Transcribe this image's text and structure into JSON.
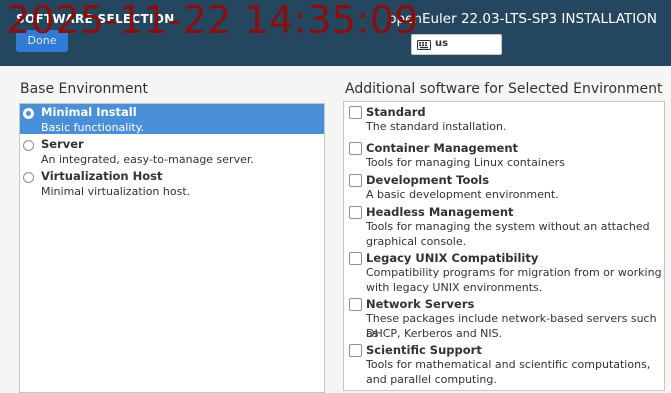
{
  "header": {
    "title": "SOFTWARE SELECTION",
    "done_label": "Done",
    "product": "openEuler 22.03-LTS-SP3 INSTALLATION",
    "keyboard_layout": "us",
    "overlay_timestamp": "2025-11-22 14:35:09"
  },
  "base_environment": {
    "heading": "Base Environment",
    "items": [
      {
        "name": "Minimal Install",
        "description": "Basic functionality.",
        "selected": true
      },
      {
        "name": "Server",
        "description": "An integrated, easy-to-manage server.",
        "selected": false
      },
      {
        "name": "Virtualization Host",
        "description": "Minimal virtualization host.",
        "selected": false
      }
    ]
  },
  "additional_software": {
    "heading": "Additional software for Selected Environment",
    "items": [
      {
        "name": "Standard",
        "description_lines": [
          "The standard installation."
        ],
        "checked": false
      },
      {
        "name": "Container Management",
        "description_lines": [
          "Tools for managing Linux containers"
        ],
        "checked": false
      },
      {
        "name": "Development Tools",
        "description_lines": [
          "A basic development environment."
        ],
        "checked": false
      },
      {
        "name": "Headless Management",
        "description_lines": [
          "Tools for managing the system without an attached",
          "graphical console."
        ],
        "checked": false
      },
      {
        "name": "Legacy UNIX Compatibility",
        "description_lines": [
          "Compatibility programs for migration from or working",
          "with legacy UNIX environments."
        ],
        "checked": false
      },
      {
        "name": "Network Servers",
        "description_lines": [
          "These packages include network-based servers such as",
          "DHCP, Kerberos and NIS."
        ],
        "checked": false
      },
      {
        "name": "Scientific Support",
        "description_lines": [
          "Tools for mathematical and scientific computations,",
          "and parallel computing."
        ],
        "checked": false
      }
    ]
  },
  "colors": {
    "header_bg": "#25465f",
    "selection_blue": "#4a90d9",
    "done_button": "#2f7bd6",
    "timestamp_overlay": "#8a0e0e"
  }
}
